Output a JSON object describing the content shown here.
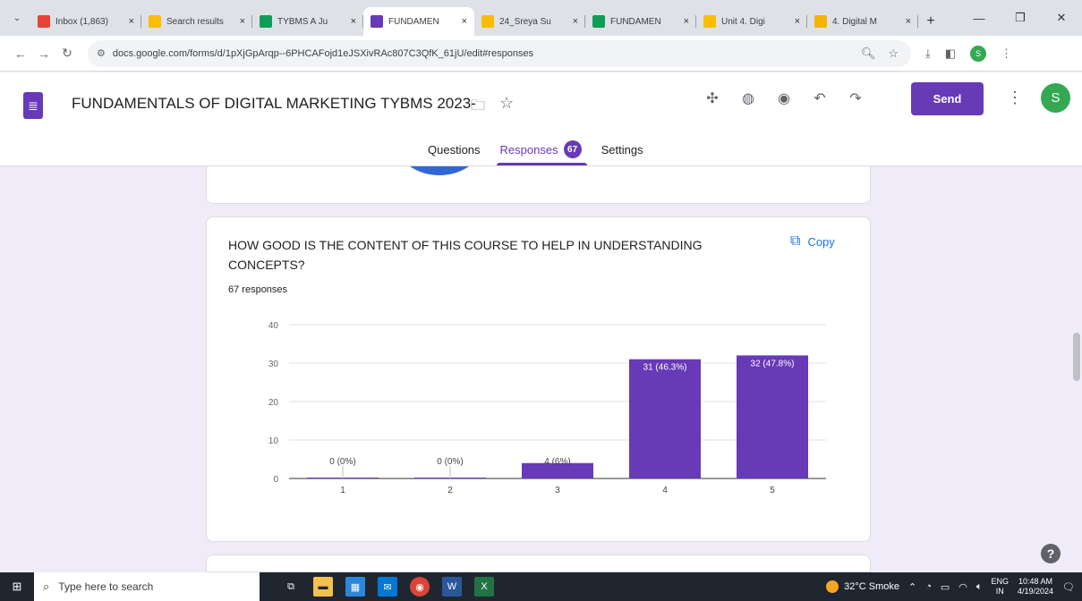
{
  "browser": {
    "tabs": [
      {
        "label": "Inbox (1,863)",
        "favicon": "gmail-icon",
        "color": "#ea4335"
      },
      {
        "label": "Search results",
        "favicon": "drive-icon",
        "color": "#fbbc04"
      },
      {
        "label": "TYBMS A Ju",
        "favicon": "sheets-icon",
        "color": "#0f9d58"
      },
      {
        "label": "FUNDAMEN",
        "favicon": "forms-icon",
        "color": "#673ab7",
        "active": true
      },
      {
        "label": "24_Sreya Su",
        "favicon": "drive-icon",
        "color": "#fbbc04"
      },
      {
        "label": "FUNDAMEN",
        "favicon": "sheets-icon",
        "color": "#0f9d58"
      },
      {
        "label": "Unit 4. Digi",
        "favicon": "drive-icon",
        "color": "#fbbc04"
      },
      {
        "label": "4. Digital M",
        "favicon": "slides-icon",
        "color": "#f4b400"
      }
    ],
    "url": "docs.google.com/forms/d/1pXjGpArqp--6PHCAFojd1eJSXivRAc807C3QfK_61jU/edit#responses"
  },
  "form": {
    "title": "FUNDAMENTALS OF DIGITAL MARKETING TYBMS 2023-",
    "send_label": "Send",
    "avatar_initial": "S",
    "tabs": [
      {
        "label": "Questions"
      },
      {
        "label": "Responses",
        "badge": "67",
        "active": true
      },
      {
        "label": "Settings"
      }
    ]
  },
  "question": {
    "title": "HOW GOOD IS THE CONTENT OF THIS COURSE TO HELP IN UNDERSTANDING CONCEPTS?",
    "copy_label": "Copy",
    "responses": "67 responses"
  },
  "chart_data": {
    "type": "bar",
    "categories": [
      "1",
      "2",
      "3",
      "4",
      "5"
    ],
    "values": [
      0,
      0,
      4,
      31,
      32
    ],
    "data_labels": [
      "0 (0%)",
      "0 (0%)",
      "4 (6%)",
      "31 (46.3%)",
      "32 (47.8%)"
    ],
    "y_ticks": [
      0,
      10,
      20,
      30,
      40
    ],
    "ylim": [
      0,
      40
    ],
    "bar_color": "#673ab7",
    "grid": true
  },
  "taskbar": {
    "search_placeholder": "Type here to search",
    "weather": "32°C  Smoke",
    "lang_top": "ENG",
    "lang_bottom": "IN",
    "time": "10:48 AM",
    "date": "4/19/2024"
  }
}
